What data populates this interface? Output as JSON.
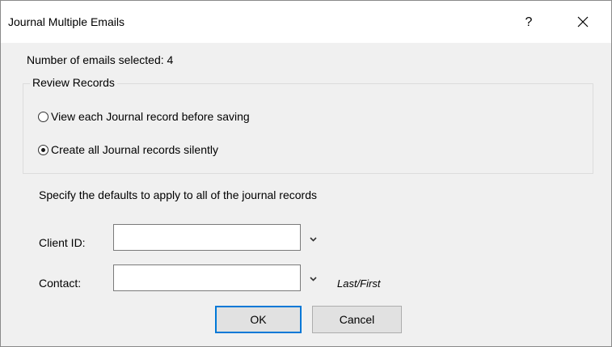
{
  "window": {
    "title": "Journal Multiple Emails",
    "help_label": "?",
    "close_icon": "close-icon"
  },
  "summary": {
    "emails_selected": "Number of emails selected: 4"
  },
  "review_records": {
    "legend": "Review Records",
    "options": [
      {
        "label": "View each Journal record before saving",
        "selected": false
      },
      {
        "label": "Create all Journal records silently",
        "selected": true
      }
    ]
  },
  "defaults": {
    "instruction": "Specify the defaults to apply to all of the journal records",
    "client_id": {
      "label": "Client ID:",
      "value": "",
      "dropdown_icon": "chevron-down-icon"
    },
    "contact": {
      "label": "Contact:",
      "value": "",
      "dropdown_icon": "chevron-down-icon",
      "hint": "Last/First"
    }
  },
  "buttons": {
    "ok": "OK",
    "cancel": "Cancel"
  },
  "colors": {
    "dialog_background": "#f0f0f0",
    "titlebar_background": "#ffffff",
    "default_button_border": "#0078d7",
    "button_face": "#e1e1e1"
  }
}
